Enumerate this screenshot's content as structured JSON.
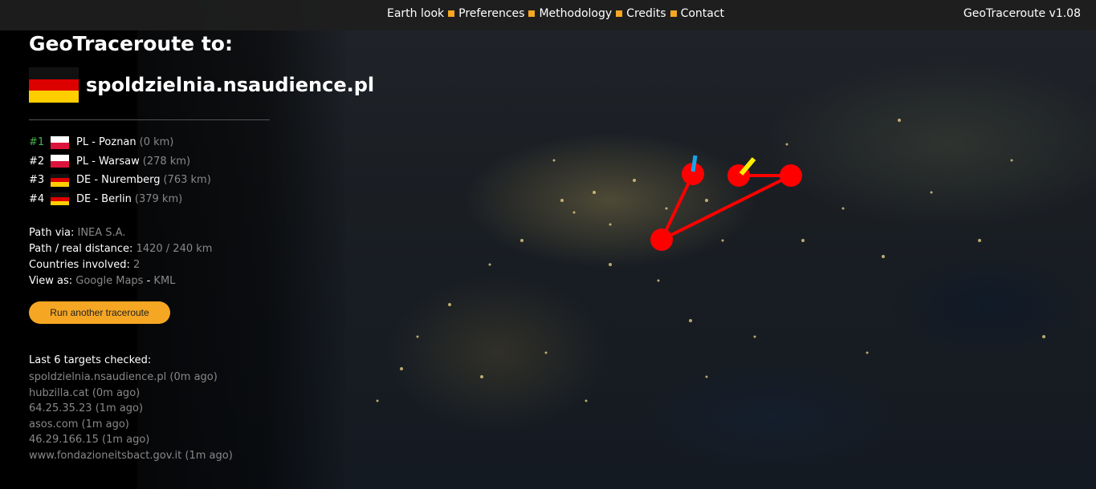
{
  "nav": {
    "items": [
      "Earth look",
      "Preferences",
      "Methodology",
      "Credits",
      "Contact"
    ],
    "version": "GeoTraceroute v1.08"
  },
  "header": {
    "title": "GeoTraceroute to:",
    "target": "spoldzielnia.nsaudience.pl",
    "target_flag": "flag-germany"
  },
  "hops": [
    {
      "num": "#1",
      "country": "PL",
      "city": "Poznan",
      "label": "PL - Poznan",
      "distance": "(0 km)"
    },
    {
      "num": "#2",
      "country": "PL",
      "city": "Warsaw",
      "label": "PL - Warsaw",
      "distance": "(278 km)"
    },
    {
      "num": "#3",
      "country": "DE",
      "city": "Nuremberg",
      "label": "DE - Nuremberg",
      "distance": "(763 km)"
    },
    {
      "num": "#4",
      "country": "DE",
      "city": "Berlin",
      "label": "DE - Berlin",
      "distance": "(379 km)"
    }
  ],
  "info": {
    "path_via_label": "Path via:",
    "path_via": "INEA S.A.",
    "distance_label": "Path / real distance:",
    "distance": "1420 / 240 km",
    "countries_label": "Countries involved:",
    "countries": "2",
    "view_label": "View as:",
    "view_google": "Google Maps",
    "view_sep": "-",
    "view_kml": "KML"
  },
  "run_button": "Run another traceroute",
  "recent": {
    "header": "Last 6 targets checked:",
    "items": [
      "spoldzielnia.nsaudience.pl (0m ago)",
      "hubzilla.cat (0m ago)",
      "64.25.35.23 (1m ago)",
      "asos.com (1m ago)",
      "46.29.166.15 (1m ago)",
      "www.fondazioneitsbact.gov.it (1m ago)"
    ]
  },
  "colors": {
    "accent": "#f5a623",
    "route": "#ff0000",
    "start_marker": "#1aa3e8",
    "end_marker": "#ffee00",
    "first_hop": "#4caf50",
    "muted": "#888888"
  }
}
